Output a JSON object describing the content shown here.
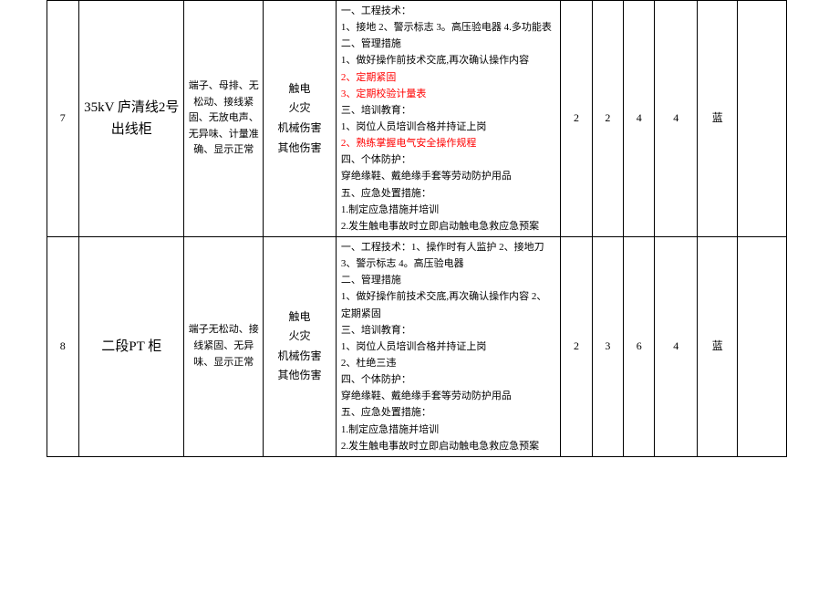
{
  "rows": [
    {
      "no": "7",
      "name": "35kV 庐清线2号出线柜",
      "desc": "端子、母排、无松动、接线紧固、无放电声、无异味、计量准确、显示正常",
      "hazard": "触电\n火灾\n机械伤害\n其他伤害",
      "measures_plain": [
        "一、工程技术：",
        "1、接地 2、警示标志 3。高压验电器 4.多功能表",
        "二、管理措施",
        "1、做好操作前技术交底,再次确认操作内容"
      ],
      "measures_red": [
        "2、定期紧固",
        "3、定期校验计量表"
      ],
      "measures_plain2": [
        "三、培训教育：",
        "1、岗位人员培训合格并持证上岗"
      ],
      "measures_red2": [
        "2、熟练掌握电气安全操作规程"
      ],
      "measures_plain3": [
        "四、个体防护：",
        "穿绝缘鞋、戴绝缘手套等劳动防护用品",
        "五、应急处置措施：",
        "1.制定应急措施并培训",
        "2.发生触电事故时立即启动触电急救应急预案"
      ],
      "c1": "2",
      "c2": "2",
      "c3": "4",
      "c4": "4",
      "color": "蓝"
    },
    {
      "no": "8",
      "name": "二段PT 柜",
      "desc": "端子无松动、接线紧固、无异味、显示正常",
      "hazard": "触电\n火灾\n机械伤害\n其他伤害",
      "measures_plain": [
        "一、工程技术：1、操作时有人监护 2、接地刀 3、警示标志 4。高压验电器",
        "二、管理措施",
        "1、做好操作前技术交底,再次确认操作内容 2、定期紧固",
        "三、培训教育：",
        "1、岗位人员培训合格并持证上岗",
        "2、杜绝三违",
        "四、个体防护：",
        "穿绝缘鞋、戴绝缘手套等劳动防护用品",
        "五、应急处置措施：",
        "1.制定应急措施并培训",
        "2.发生触电事故时立即启动触电急救应急预案"
      ],
      "measures_red": [],
      "measures_plain2": [],
      "measures_red2": [],
      "measures_plain3": [],
      "c1": "2",
      "c2": "3",
      "c3": "6",
      "c4": "4",
      "color": "蓝"
    }
  ]
}
